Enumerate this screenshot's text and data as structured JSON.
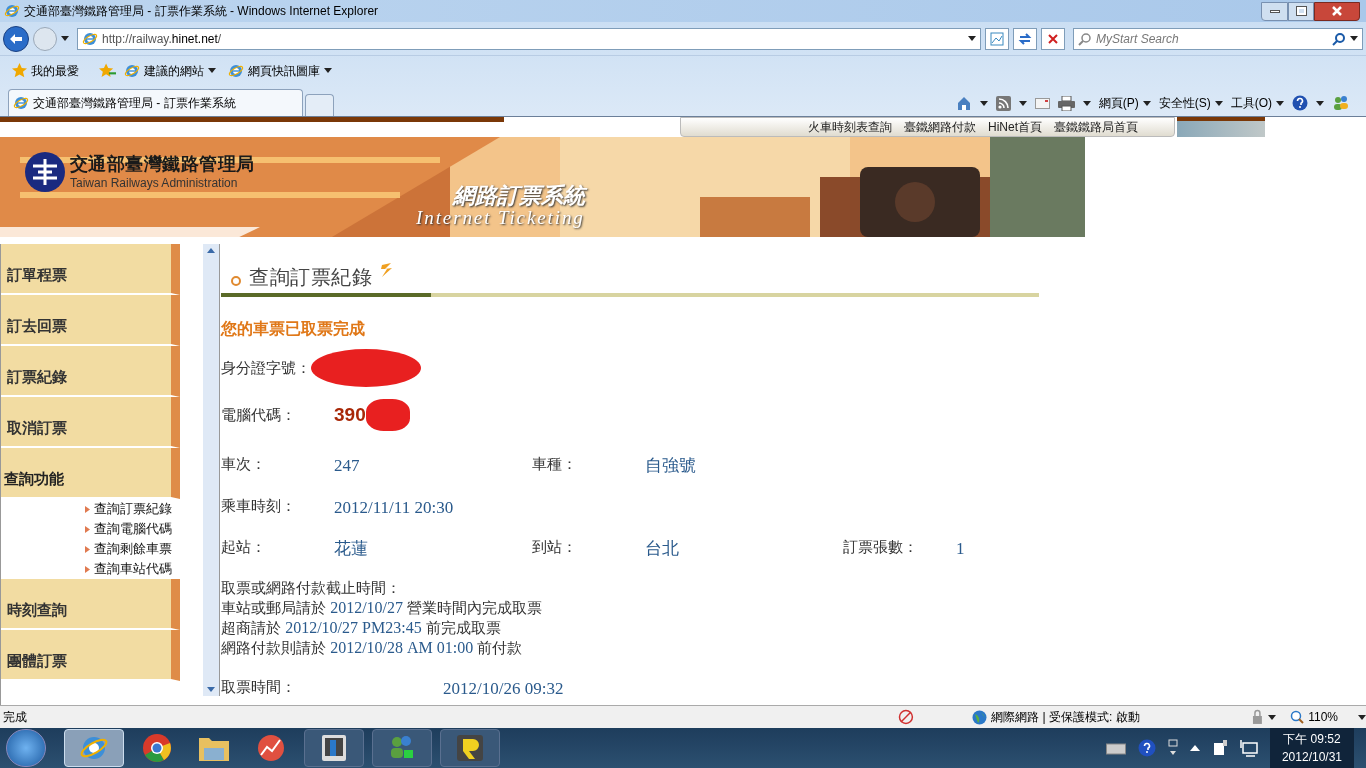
{
  "window": {
    "title": "交通部臺灣鐵路管理局 - 訂票作業系統 - Windows Internet Explorer"
  },
  "address_bar": {
    "url_prefix": "http://railway.",
    "url_domain": "hinet.net",
    "url_suffix": "/"
  },
  "search": {
    "placeholder": "MyStart Search"
  },
  "favorites_bar": {
    "favorites": "我的最愛",
    "links": [
      "建議的網站",
      "網頁快訊圖庫"
    ]
  },
  "tabs": [
    {
      "label": "交通部臺灣鐵路管理局 - 訂票作業系統",
      "selected": true
    }
  ],
  "command_bar": [
    "網頁(P)",
    "安全性(S)",
    "工具(O)"
  ],
  "site_nav": [
    "火車時刻表查詢",
    "臺鐵網路付款",
    "HiNet首頁",
    "臺鐵鐵路局首頁"
  ],
  "banner": {
    "org_name": "交通部臺灣鐵路管理局",
    "org_name_en": "Taiwan Railways Administration",
    "system_name": "網路訂票系統",
    "system_name_en": "Internet Ticketing"
  },
  "sidebar": {
    "items": [
      {
        "label": "訂單程票",
        "expanded": false
      },
      {
        "label": "訂去回票",
        "expanded": false
      },
      {
        "label": "訂票紀錄",
        "expanded": false
      },
      {
        "label": "取消訂票",
        "expanded": false
      },
      {
        "label": "查詢功能",
        "expanded": true,
        "children": [
          "查詢訂票紀錄",
          "查詢電腦代碼",
          "查詢剩餘車票",
          "查詢車站代碼"
        ]
      },
      {
        "label": "時刻查詢",
        "expanded": false
      },
      {
        "label": "團體訂票",
        "expanded": false
      }
    ]
  },
  "content": {
    "heading": "查詢訂票紀錄",
    "status_message": "您的車票已取票完成",
    "id_label": "身分證字號：",
    "code_label": "電腦代碼：",
    "code_value": "390",
    "rows": [
      [
        {
          "label": "車次：",
          "value": "247"
        },
        {
          "label": "車種：",
          "value": "自強號"
        }
      ],
      [
        {
          "label": "乘車時刻：",
          "value": "2012/11/11 20:30"
        }
      ],
      [
        {
          "label": "起站：",
          "value": "花蓮"
        },
        {
          "label": "到站：",
          "value": "台北"
        },
        {
          "label": "訂票張數：",
          "value": "1"
        }
      ]
    ],
    "deadline_title": "取票或網路付款截止時間：",
    "deadlines": [
      "車站或郵局請於 **2012/10/27** 營業時間內完成取票",
      "超商請於 **2012/10/27 PM23:45** 前完成取票",
      "網路付款則請於 **2012/10/28 AM 01:00** 前付款"
    ],
    "pickup_label": "取票時間：",
    "pickup_value": "2012/10/26 09:32"
  },
  "status_bar": {
    "text": "完成",
    "zone": "網際網路 | 受保護模式: 啟動",
    "zoom": "110%"
  },
  "taskbar": {
    "time": "下午 09:52",
    "date": "2012/10/31"
  }
}
